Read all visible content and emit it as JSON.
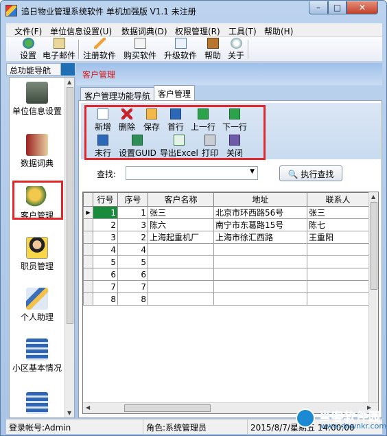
{
  "window": {
    "title": "追日物业管理系统软件 单机加强版 V1.1 未注册",
    "min": "–",
    "max": "□",
    "close": "✕"
  },
  "menu": [
    "文件(F)",
    "单位信息设置(U)",
    "数据词典(D)",
    "权限管理(R)",
    "工具(T)",
    "帮助(H)"
  ],
  "toolbar": [
    "设置",
    "电子邮件",
    "注册软件",
    "购买软件",
    "升级软件",
    "帮助",
    "关于"
  ],
  "nav": {
    "header": "总功能导航",
    "items": [
      "单位信息设置",
      "数据词典",
      "客户管理",
      "职员管理",
      "个人助理",
      "小区基本情况"
    ]
  },
  "main": {
    "title": "客户管理",
    "tabs": [
      "客户管理功能导航",
      "客户管理"
    ],
    "actions_row1": [
      "新增",
      "删除",
      "保存",
      "首行",
      "上一行",
      "下一行"
    ],
    "actions_row2": [
      "末行",
      "设置GUID",
      "导出Excel",
      "打印",
      "关闭"
    ],
    "search_label": "查找:",
    "search_button": "执行查找"
  },
  "grid": {
    "columns": [
      "行号",
      "序号",
      "客户名称",
      "地址",
      "联系人"
    ],
    "rows": [
      [
        "1",
        "1",
        "张三",
        "北京市环西路56号",
        "张三"
      ],
      [
        "2",
        "3",
        "陈六",
        "南宁市东葛路15号",
        "陈七"
      ],
      [
        "3",
        "2",
        "上海起重机厂",
        "上海市徐汇西路",
        "王重阳"
      ],
      [
        "4",
        "4",
        "",
        "",
        ""
      ],
      [
        "5",
        "5",
        "",
        "",
        ""
      ],
      [
        "6",
        "6",
        "",
        "",
        ""
      ],
      [
        "7",
        "7",
        "",
        "",
        ""
      ],
      [
        "8",
        "8",
        "",
        "",
        ""
      ]
    ]
  },
  "status": {
    "login": "登录帐号:Admin",
    "role": "角色:系统管理员",
    "date": "2015/8/7/星期五 14:00:00"
  },
  "watermark": {
    "brand": "当客软件园",
    "url": "www.downkr.com"
  }
}
